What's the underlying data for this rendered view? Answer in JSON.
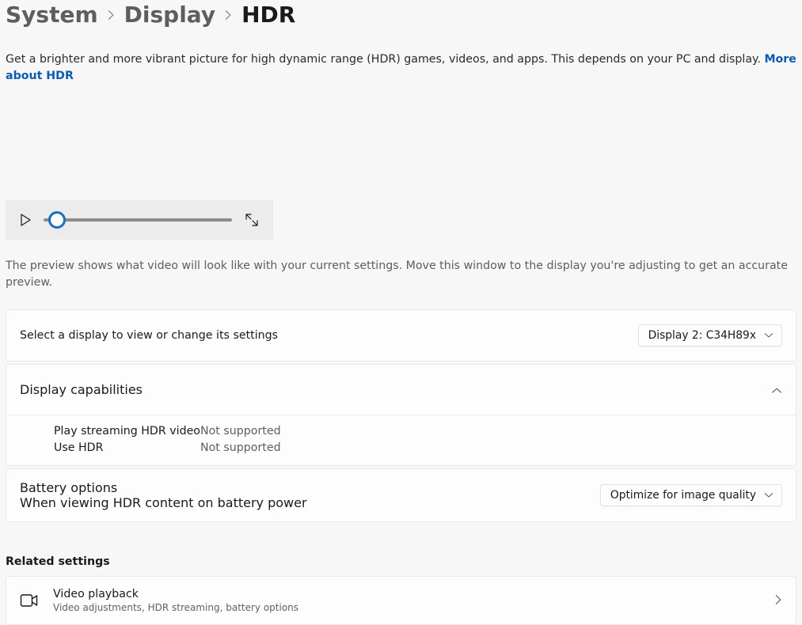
{
  "breadcrumb": {
    "system": "System",
    "display": "Display",
    "current": "HDR"
  },
  "description": {
    "text": "Get a brighter and more vibrant picture for high dynamic range (HDR) games, videos, and apps. This depends on your PC and display. ",
    "link": "More about HDR"
  },
  "preview_caption": "The preview shows what video will look like with your current settings. Move this window to the display you're adjusting to get an accurate preview.",
  "display_select": {
    "label": "Select a display to view or change its settings",
    "value": "Display 2: C34H89x"
  },
  "capabilities": {
    "heading": "Display capabilities",
    "rows": [
      {
        "label": "Play streaming HDR video",
        "value": "Not supported"
      },
      {
        "label": "Use HDR",
        "value": "Not supported"
      }
    ]
  },
  "battery": {
    "label": "Battery options",
    "sublabel": "When viewing HDR content on battery power",
    "value": "Optimize for image quality"
  },
  "related": {
    "heading": "Related settings",
    "video_playback": {
      "title": "Video playback",
      "subtitle": "Video adjustments, HDR streaming, battery options"
    }
  }
}
